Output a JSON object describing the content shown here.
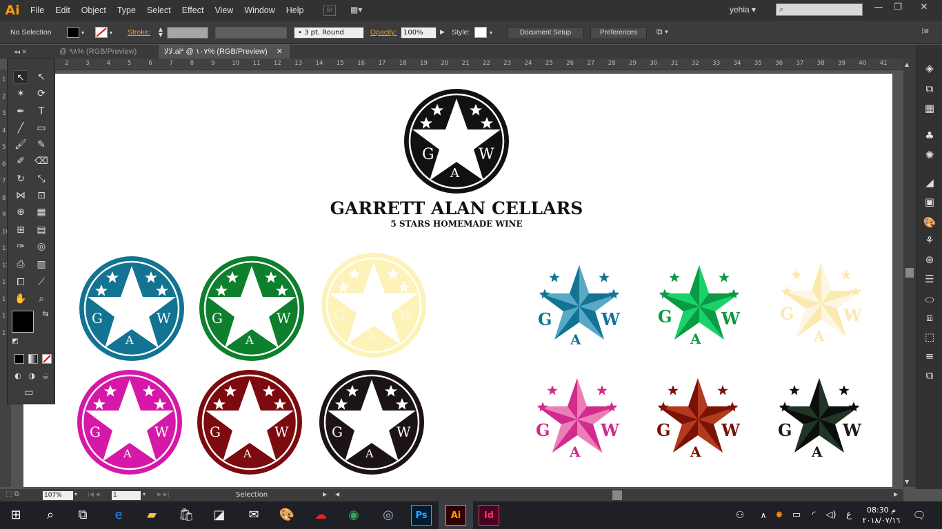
{
  "app": {
    "logo": "Ai",
    "user": "yehia"
  },
  "menu": [
    "File",
    "Edit",
    "Object",
    "Type",
    "Select",
    "Effect",
    "View",
    "Window",
    "Help"
  ],
  "menubar_extras": {
    "bridge": "Br",
    "arrange": "▦▾",
    "search_icon": "⌕"
  },
  "window_controls": {
    "minimize": "—",
    "restore": "❐",
    "close": "✕"
  },
  "control": {
    "selection": "No Selection",
    "stroke_label": "Stroke:",
    "brush": "• 3 pt. Round",
    "opacity_label": "Opacity:",
    "opacity_value": "100%",
    "style_label": "Style:",
    "document_setup": "Document Setup",
    "preferences": "Preferences"
  },
  "tabs": [
    {
      "label": "@ ٩٨% (RGB/Preview)",
      "close": "✕"
    },
    {
      "label": "لالا.ai* @ ١٠٧% (RGB/Preview)",
      "close": "✕"
    }
  ],
  "ruler_h": [
    "2",
    "3",
    "4",
    "5",
    "6",
    "7",
    "8",
    "9",
    "10",
    "11",
    "12",
    "13",
    "14",
    "15",
    "16",
    "17",
    "18",
    "19",
    "20",
    "21",
    "22",
    "23",
    "24",
    "25",
    "26",
    "27",
    "28",
    "29",
    "30",
    "31",
    "32",
    "33",
    "34",
    "35",
    "36",
    "37",
    "38",
    "39",
    "40",
    "41"
  ],
  "ruler_v": [
    "1",
    "2",
    "3",
    "4",
    "5",
    "6",
    "7",
    "8",
    "9",
    "10",
    "11",
    "12",
    "1",
    "1",
    "1",
    "1"
  ],
  "logo": {
    "brand": "GARRETT ALAN CELLARS",
    "tagline": "5 STARS HOMEMADE WINE",
    "letters": [
      "G",
      "A",
      "W"
    ]
  },
  "colors": {
    "black": "#111111",
    "blue": "#137392",
    "green": "#0d7f2d",
    "cream": "#fdf2b8",
    "magenta": "#d618a8",
    "maroon": "#7c0a0f",
    "darkbrown": "#1b1314",
    "star_blue_dark": "#137392",
    "star_blue_light": "#58a9c8",
    "star_green_dark": "#0a9a44",
    "star_green_light": "#1ad26a",
    "star_cream_dark": "#fbe9b0",
    "star_cream_light": "#fdf6e4",
    "star_pink_dark": "#d32a8e",
    "star_pink_light": "#ea7fb5",
    "star_red_dark": "#7a1207",
    "star_red_light": "#b23b1d",
    "star_black_dark": "#0d0d0d",
    "star_black_light": "#1f3525"
  },
  "status": {
    "zoom": "107%",
    "page": "1",
    "mode": "Selection"
  },
  "taskbar": {
    "time": "08:30 م",
    "date": "٢٠١٨/٠٧/١٦",
    "ps": "Ps",
    "ai": "Ai",
    "id": "Id",
    "lang": "ع"
  }
}
